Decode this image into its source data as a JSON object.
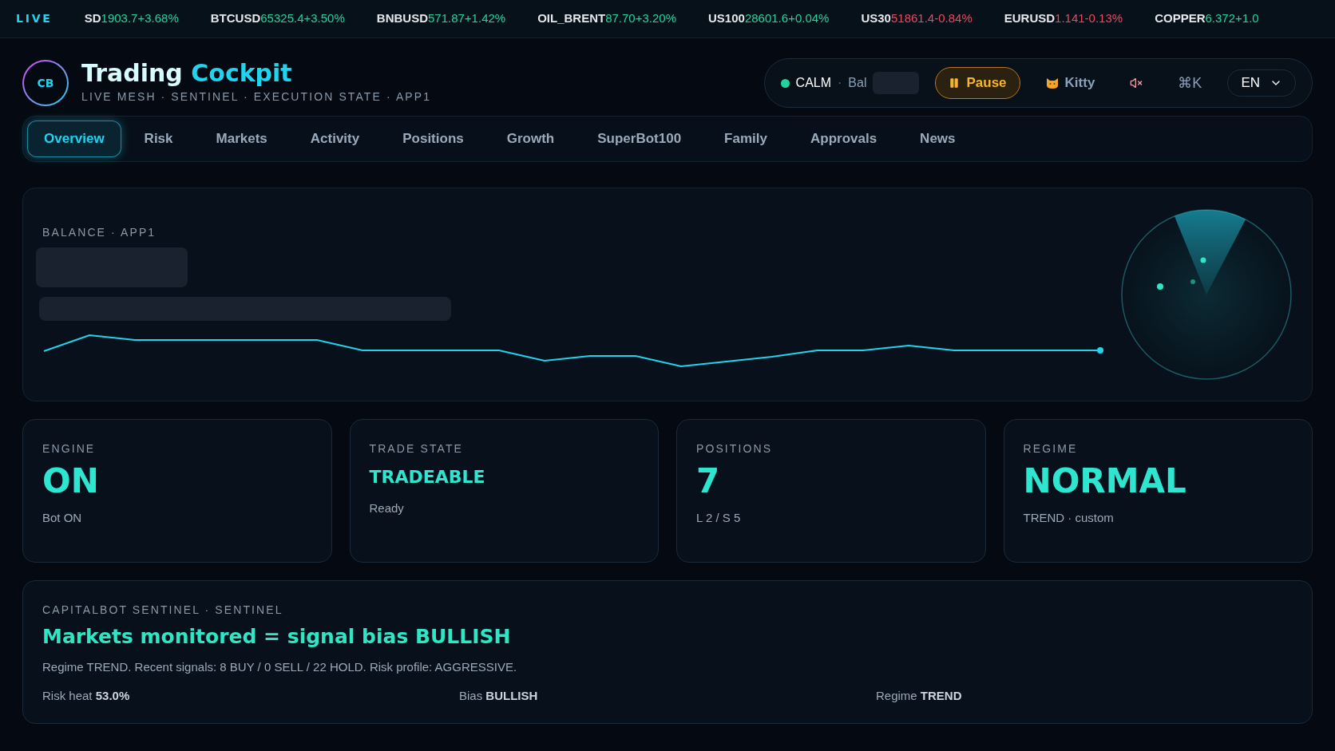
{
  "ticker": {
    "live_label": "LIVE",
    "items": [
      {
        "symbol": "SD",
        "price": "1903.7",
        "change": "+3.68%",
        "color": "#22d3a0"
      },
      {
        "symbol": "BTCUSD",
        "price": "65325.4",
        "change": "+3.50%",
        "color": "#22d3a0"
      },
      {
        "symbol": "BNBUSD",
        "price": "571.87",
        "change": "+1.42%",
        "color": "#22d3a0"
      },
      {
        "symbol": "OIL_BRENT",
        "price": "87.70",
        "change": "+3.20%",
        "color": "#22d3a0"
      },
      {
        "symbol": "US100",
        "price": "28601.6",
        "change": "+0.04%",
        "color": "#22d3a0"
      },
      {
        "symbol": "US30",
        "price": "51861.4",
        "change": "-0.84%",
        "color": "#f0475e"
      },
      {
        "symbol": "EURUSD",
        "price": "1.141",
        "change": "-0.13%",
        "color": "#f0475e"
      },
      {
        "symbol": "COPPER",
        "price": "6.372",
        "change": "+1.0",
        "color": "#22d3a0"
      }
    ]
  },
  "header": {
    "logo": "CB",
    "title_first": "Trading",
    "title_second": "Cockpit",
    "subtitle": "LIVE MESH · SENTINEL · EXECUTION STATE · APP1",
    "status": {
      "label": "CALM",
      "separator": "·",
      "balance_label": "Bal"
    },
    "pause_button": "Pause",
    "kitty_button": "Kitty",
    "shortcut": "⌘K",
    "language": "EN"
  },
  "tabs": [
    {
      "label": "Overview",
      "selected": true
    },
    {
      "label": "Risk",
      "selected": false
    },
    {
      "label": "Markets",
      "selected": false
    },
    {
      "label": "Activity",
      "selected": false
    },
    {
      "label": "Positions",
      "selected": false
    },
    {
      "label": "Growth",
      "selected": false
    },
    {
      "label": "SuperBot100",
      "selected": false
    },
    {
      "label": "Family",
      "selected": false
    },
    {
      "label": "Approvals",
      "selected": false
    },
    {
      "label": "News",
      "selected": false
    }
  ],
  "balance": {
    "label": "BALANCE · APP1"
  },
  "cards": [
    {
      "kind": "metric",
      "label": "ENGINE",
      "value": "ON",
      "sub": "Bot ON"
    },
    {
      "kind": "status",
      "label": "TRADE STATE",
      "value": "TRADEABLE",
      "sub": "Ready"
    },
    {
      "kind": "metric",
      "label": "POSITIONS",
      "value": "7",
      "sub": "L 2 / S 5"
    },
    {
      "kind": "metric",
      "label": "REGIME",
      "value": "NORMAL",
      "sub": "TREND · custom"
    }
  ],
  "sentinel": {
    "label": "CAPITALBOT SENTINEL · SENTINEL",
    "headline": "Markets monitored = signal bias BULLISH",
    "summary": "Regime TREND. Recent signals: 8 BUY / 0 SELL / 22 HOLD. Risk profile: AGGRESSIVE.",
    "stats": [
      {
        "label": "Risk heat",
        "value": "53.0%"
      },
      {
        "label": "Bias",
        "value": "BULLISH"
      },
      {
        "label": "Regime",
        "value": "TREND"
      }
    ]
  }
}
